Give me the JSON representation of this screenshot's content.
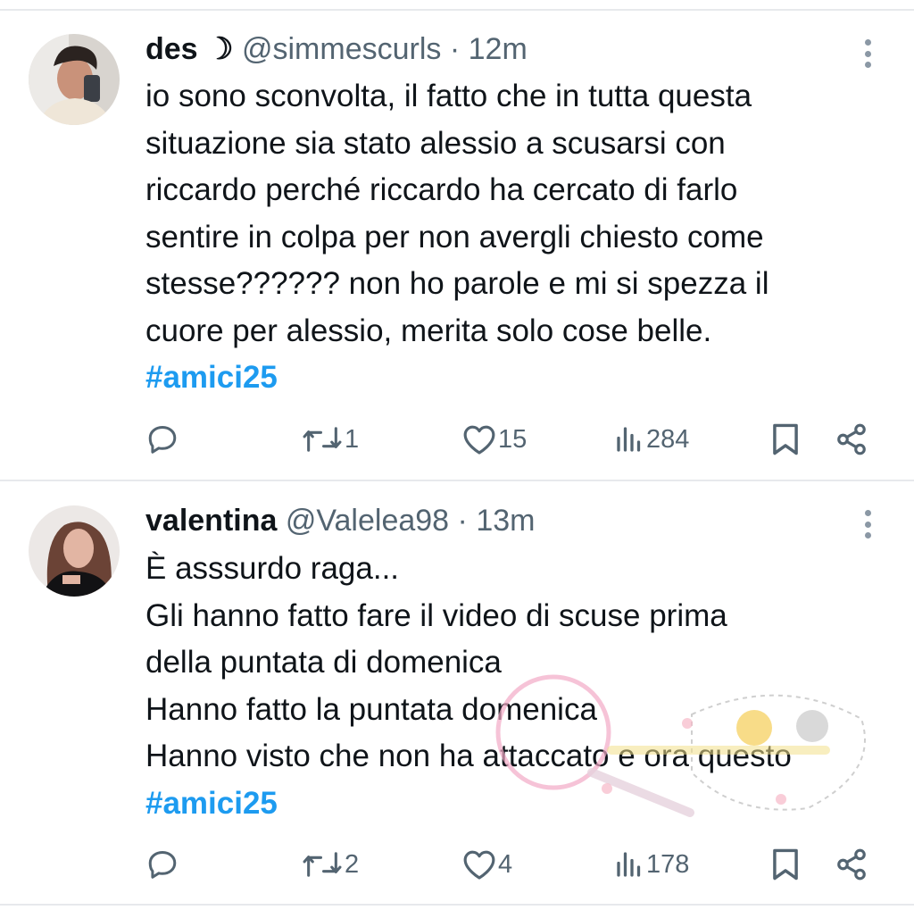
{
  "tweets": [
    {
      "author_name": "des",
      "author_emoji": "☽",
      "handle": "@simmescurls",
      "separator": "·",
      "time": "12m",
      "text_lines": [
        "io sono sconvolta, il fatto che in tutta questa",
        "situazione sia stato alessio a scusarsi con",
        "riccardo perché riccardo ha cercato di farlo",
        "sentire in colpa per non avergli chiesto come",
        "stesse?????? non ho parole e mi si spezza il",
        "cuore per alessio, merita solo cose belle."
      ],
      "hashtag": "#amici25",
      "replies": "",
      "reposts": "1",
      "likes": "15",
      "views": "284",
      "avatar_icon": "avatar-photo"
    },
    {
      "author_name": "valentina",
      "handle": "@Valelea98",
      "separator": "·",
      "time": "13m",
      "text_lines": [
        "È asssurdo raga...",
        "Gli hanno fatto fare il video di scuse prima",
        "della puntata di domenica",
        "Hanno fatto la puntata domenica",
        "Hanno visto che non ha attaccato e ora questo"
      ],
      "hashtag": "#amici25",
      "replies": "",
      "reposts": "2",
      "likes": "4",
      "views": "178",
      "avatar_icon": "avatar-photo"
    }
  ],
  "icons": {
    "reply": "reply-icon",
    "repost": "repost-icon",
    "like": "heart-icon",
    "views": "views-icon",
    "bookmark": "bookmark-icon",
    "share": "share-icon",
    "more": "more-vertical-icon"
  },
  "colors": {
    "text": "#0f1419",
    "secondary": "#536471",
    "hashtag": "#1d9bf0",
    "separator": "#e7e9ec"
  }
}
